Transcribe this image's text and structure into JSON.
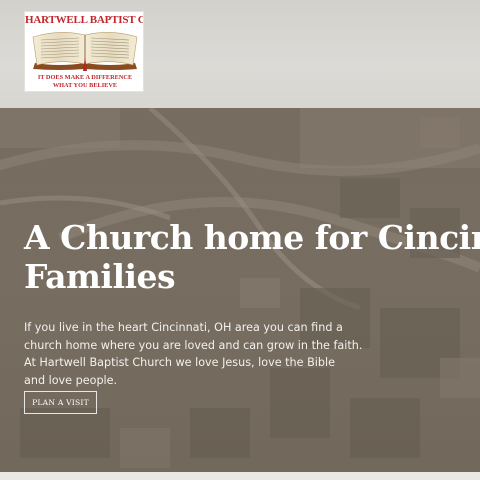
{
  "header": {
    "logo": {
      "title": "HARTWELL BAPTIST CHURCH",
      "tagline_line1": "IT DOES MAKE A DIFFERENCE",
      "tagline_line2": "WHAT YOU BELIEVE",
      "icon": "open-bible-icon"
    }
  },
  "hero": {
    "headline_line1": "A Church home for Cincinnati",
    "headline_line2": "Families",
    "intro_lines": [
      "If you live in the heart Cincinnati, OH area you can find a",
      "church home where you are loved and can grow in the faith.",
      "At Hartwell Baptist Church we love Jesus, love the Bible",
      "and love people."
    ],
    "cta_label": "PLAN A VISIT",
    "background": "aerial-city-photo"
  },
  "colors": {
    "logo_red": "#c3262a",
    "hero_overlay": "#756b5f",
    "header_bg": "#d9d7d3",
    "text_light": "#ffffff"
  }
}
